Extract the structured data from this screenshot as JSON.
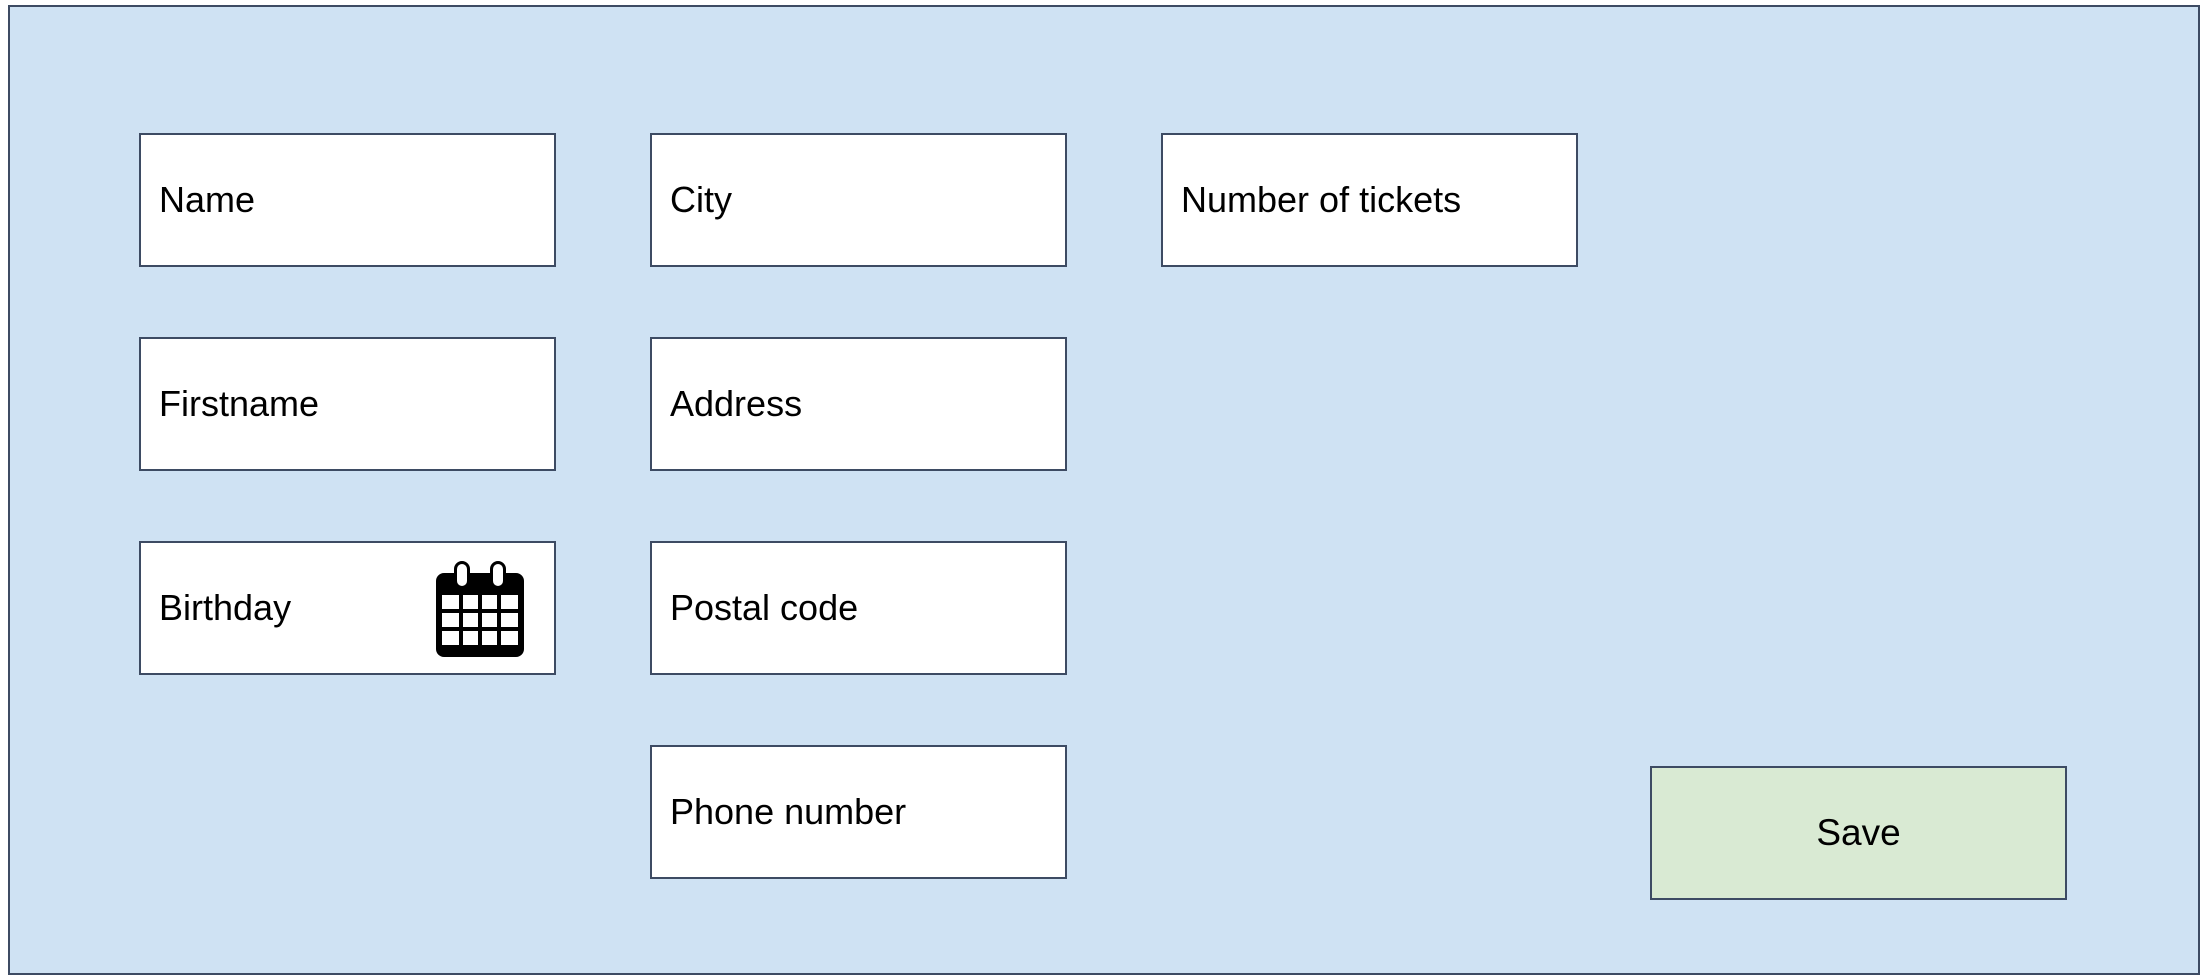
{
  "form": {
    "fields": {
      "name": "Name",
      "firstname": "Firstname",
      "birthday": "Birthday",
      "city": "City",
      "address": "Address",
      "postal_code": "Postal code",
      "phone_number": "Phone number",
      "number_of_tickets": "Number of tickets"
    },
    "save_label": "Save"
  },
  "icons": {
    "birthday_picker": "calendar-icon"
  },
  "colors": {
    "background": "#cfe2f3",
    "field_background": "#ffffff",
    "border": "#3d4b63",
    "save_button": "#d9ead3"
  }
}
